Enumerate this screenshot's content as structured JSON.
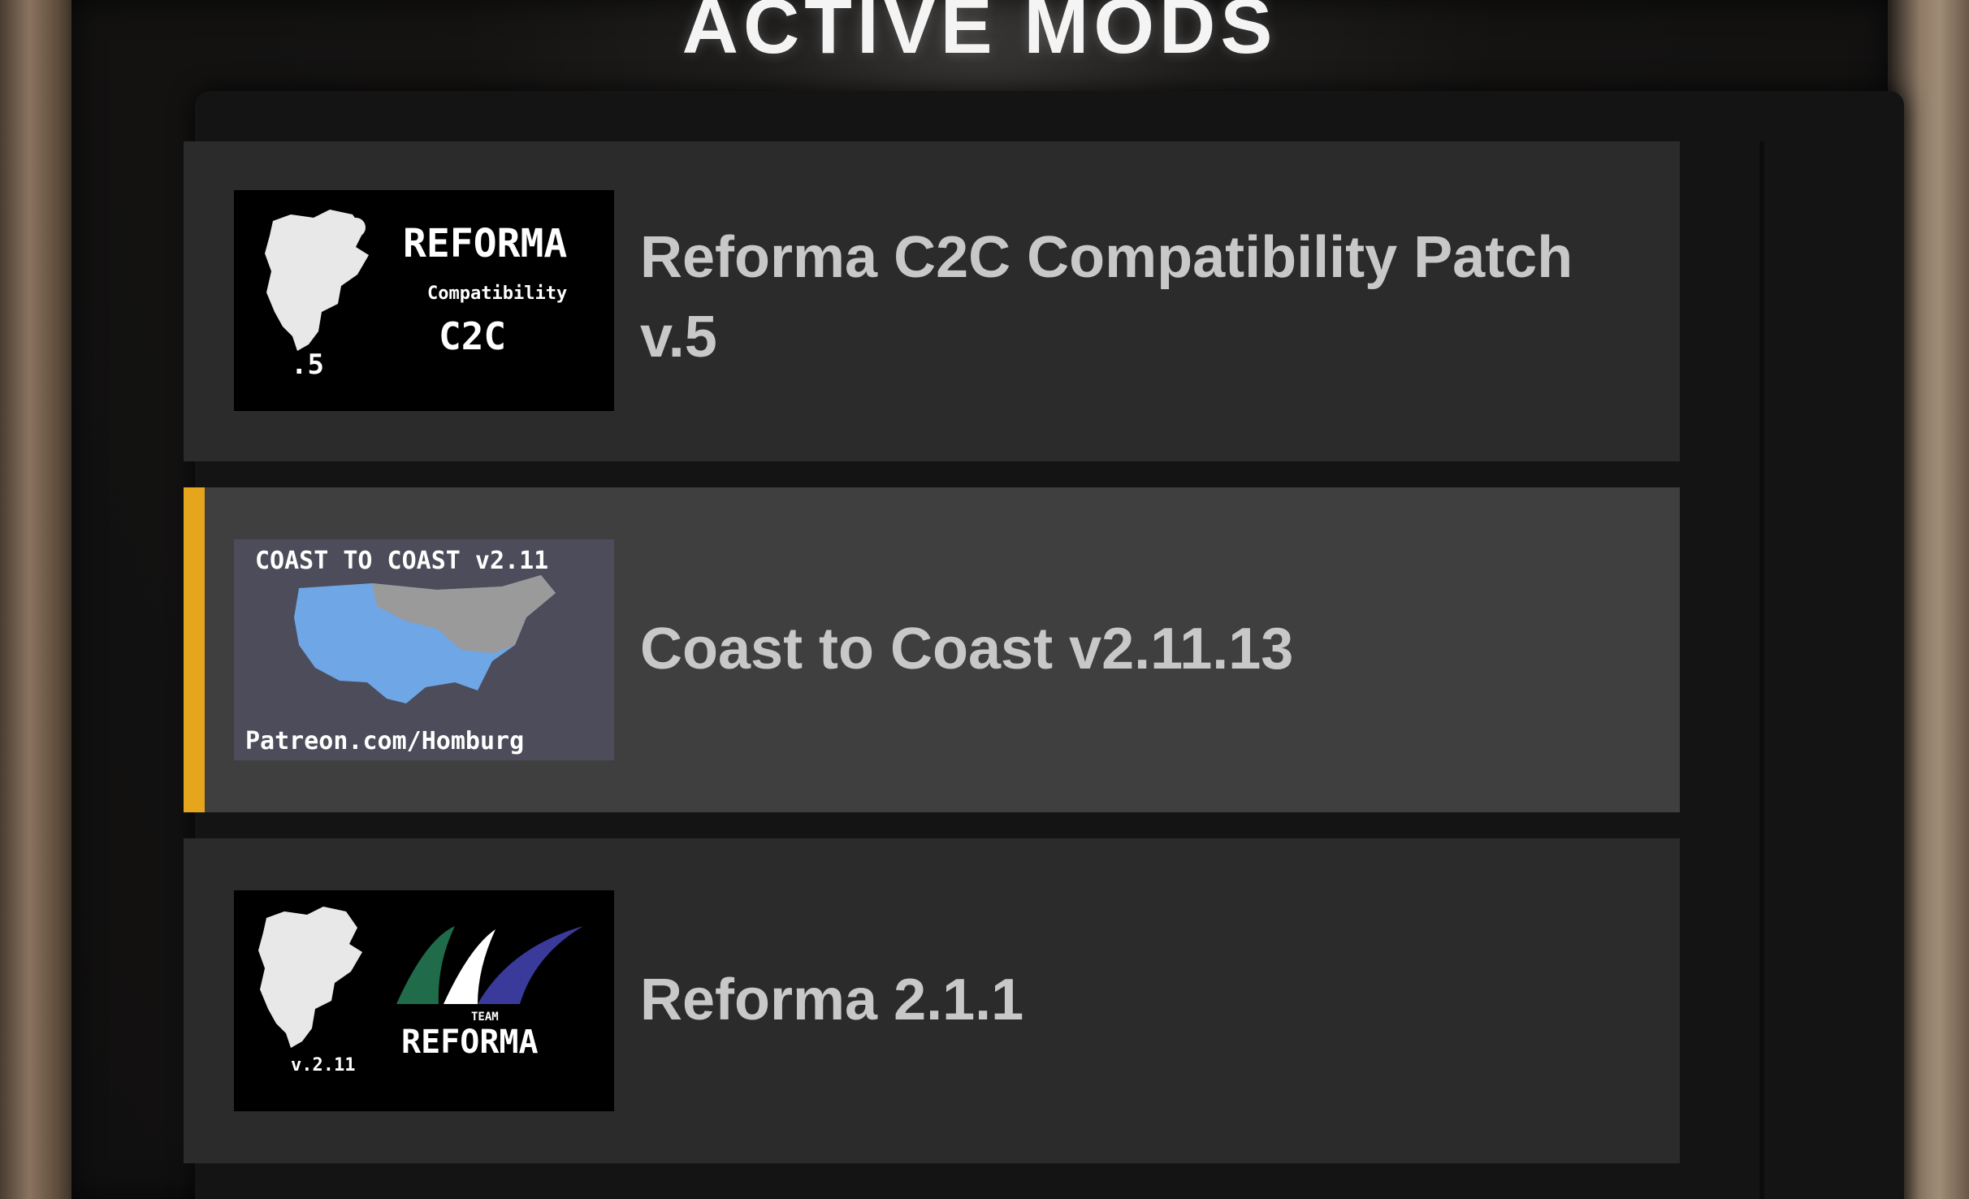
{
  "header": {
    "title": "ACTIVE MODS"
  },
  "mods": [
    {
      "name": "Reforma C2C Compatibility Patch v.5",
      "thumbnail": {
        "brand": "REFORMA",
        "subtitle": "Compatibility",
        "tag": "C2C",
        "version": ".5"
      },
      "selected": false
    },
    {
      "name": "Coast to Coast v2.11.13",
      "thumbnail": {
        "title": "COAST TO COAST v2.11",
        "footer": "Patreon.com/Homburg"
      },
      "selected": true
    },
    {
      "name": "Reforma 2.1.1",
      "thumbnail": {
        "brand": "REFORMA",
        "small": "TEAM",
        "version": "v.2.11"
      },
      "selected": false
    }
  ],
  "colors": {
    "accent": "#e5a51c",
    "item_bg": "#2b2b2b",
    "item_selected_bg": "#3f3f3f",
    "text": "#c8c8c8",
    "map_blue": "#6ea6e6",
    "map_gray": "#9a9a9a"
  }
}
